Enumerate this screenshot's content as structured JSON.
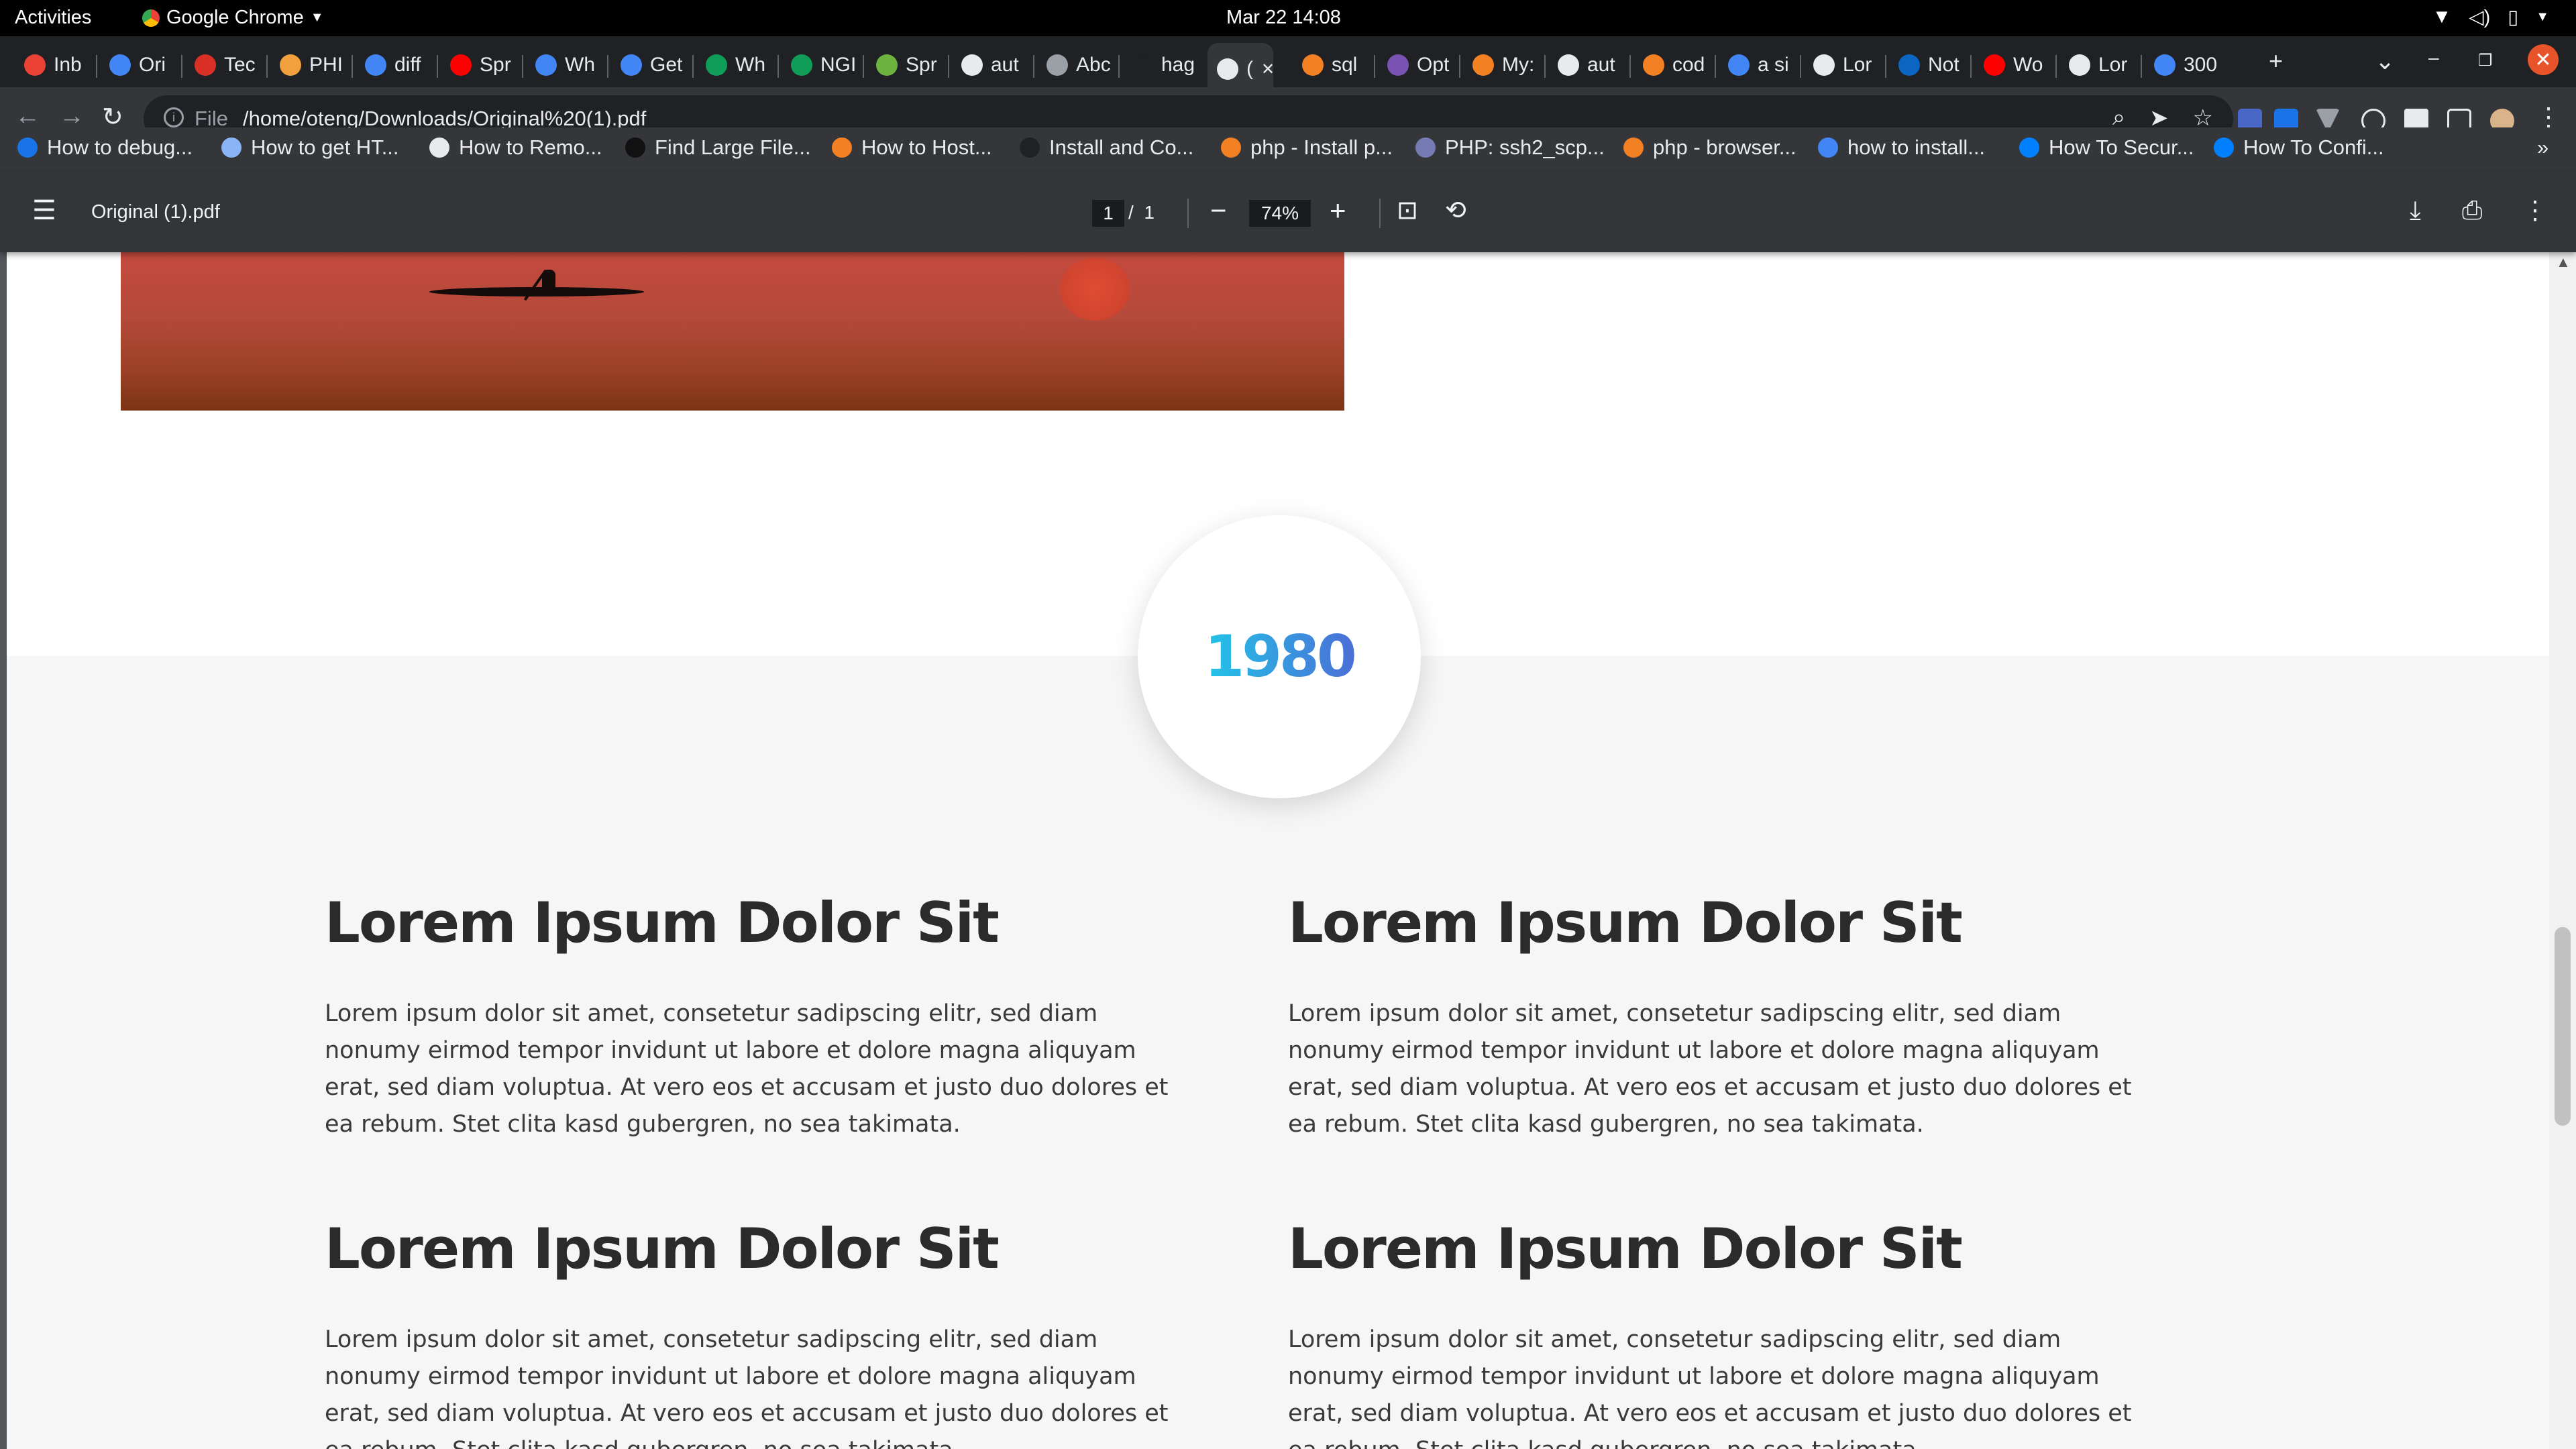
{
  "topbar": {
    "activities": "Activities",
    "app_name": "Google Chrome",
    "clock": "Mar 22  14:08"
  },
  "tabs": [
    {
      "label": "Inb",
      "favicon": "gmail-icon",
      "color": "#ea4335"
    },
    {
      "label": "Ori",
      "favicon": "docs-icon",
      "color": "#4285f4"
    },
    {
      "label": "Tec",
      "favicon": "site-icon",
      "color": "#d93025"
    },
    {
      "label": "PHI",
      "favicon": "php-icon",
      "color": "#f2a03d"
    },
    {
      "label": "diff",
      "favicon": "google-icon",
      "color": "#4285f4"
    },
    {
      "label": "Spr",
      "favicon": "youtube-icon",
      "color": "#ff0000"
    },
    {
      "label": "Wh",
      "favicon": "google-icon",
      "color": "#4285f4"
    },
    {
      "label": "Get",
      "favicon": "google-icon",
      "color": "#4285f4"
    },
    {
      "label": "Wh",
      "favicon": "nginx-icon",
      "color": "#0f9d58"
    },
    {
      "label": "NGI",
      "favicon": "nginx-icon",
      "color": "#0f9d58"
    },
    {
      "label": "Spr",
      "favicon": "spring-icon",
      "color": "#6db33f"
    },
    {
      "label": "aut",
      "favicon": "page-icon",
      "color": "#e8eaed"
    },
    {
      "label": "Abc",
      "favicon": "site-icon",
      "color": "#9aa0a6"
    },
    {
      "label": "hag",
      "favicon": "site-icon",
      "color": "#202124"
    },
    {
      "label": "(",
      "favicon": "globe-icon",
      "color": "#e8eaed"
    },
    {
      "label": "sql",
      "favicon": "stackoverflow-icon",
      "color": "#f48024"
    },
    {
      "label": "Opt",
      "favicon": "bootstrap-icon",
      "color": "#7952b3"
    },
    {
      "label": "My:",
      "favicon": "stackoverflow-icon",
      "color": "#f48024"
    },
    {
      "label": "aut",
      "favicon": "page-icon",
      "color": "#e8eaed"
    },
    {
      "label": "cod",
      "favicon": "stackoverflow-icon",
      "color": "#f48024"
    },
    {
      "label": "a si",
      "favicon": "google-icon",
      "color": "#4285f4"
    },
    {
      "label": "Lor",
      "favicon": "globe-icon",
      "color": "#e8eaed"
    },
    {
      "label": "Not",
      "favicon": "linkedin-icon",
      "color": "#0a66c2"
    },
    {
      "label": "Wo",
      "favicon": "youtube-icon",
      "color": "#ff0000"
    },
    {
      "label": "Lor",
      "favicon": "globe-icon",
      "color": "#e8eaed"
    },
    {
      "label": "300",
      "favicon": "google-icon",
      "color": "#4285f4"
    }
  ],
  "toolbar": {
    "scheme": "File",
    "url": "/home/oteng/Downloads/Original%20(1).pdf"
  },
  "bookmarks": [
    {
      "label": "How to debug...",
      "color": "#1a73e8"
    },
    {
      "label": "How to get HT...",
      "color": "#8ab4f8"
    },
    {
      "label": "How to Remo...",
      "color": "#e8eaed"
    },
    {
      "label": "Find Large File...",
      "color": "#111111"
    },
    {
      "label": "How to Host...",
      "color": "#f48024"
    },
    {
      "label": "Install and Co...",
      "color": "#202124"
    },
    {
      "label": "php - Install p...",
      "color": "#f48024"
    },
    {
      "label": "PHP: ssh2_scp...",
      "color": "#777bb3"
    },
    {
      "label": "php - browser...",
      "color": "#f48024"
    },
    {
      "label": "how to install...",
      "color": "#4285f4"
    },
    {
      "label": "How To Secur...",
      "color": "#0080ff"
    },
    {
      "label": "How To Confi...",
      "color": "#0080ff"
    }
  ],
  "pdf_viewer": {
    "filename": "Original (1).pdf",
    "current_page": "1",
    "page_separator": "/",
    "total_pages": "1",
    "zoom": "74%"
  },
  "document": {
    "year": "1980",
    "blocks": [
      {
        "title": "Lorem Ipsum Dolor Sit",
        "body": "Lorem ipsum dolor sit amet, consetetur sadipscing elitr, sed diam nonumy eirmod tempor invidunt ut labore et dolore magna aliquyam erat, sed diam voluptua. At vero eos et accusam et justo duo dolores et ea rebum. Stet clita kasd gubergren, no sea takimata."
      },
      {
        "title": "Lorem Ipsum Dolor Sit",
        "body": "Lorem ipsum dolor sit amet, consetetur sadipscing elitr, sed diam nonumy eirmod tempor invidunt ut labore et dolore magna aliquyam erat, sed diam voluptua. At vero eos et accusam et justo duo dolores et ea rebum. Stet clita kasd gubergren, no sea takimata."
      },
      {
        "title": "Lorem Ipsum Dolor Sit",
        "body": "Lorem ipsum dolor sit amet, consetetur sadipscing elitr, sed diam nonumy eirmod tempor invidunt ut labore et dolore magna aliquyam erat, sed diam voluptua. At vero eos et accusam et justo duo dolores et ea rebum. Stet clita kasd gubergren, no sea takimata."
      },
      {
        "title": "Lorem Ipsum Dolor Sit",
        "body": "Lorem ipsum dolor sit amet, consetetur sadipscing elitr, sed diam nonumy eirmod tempor invidunt ut labore et dolore magna aliquyam erat, sed diam voluptua. At vero eos et accusam et justo duo dolores et ea rebum. Stet clita kasd gubergren, no sea takimata."
      }
    ]
  },
  "colors": {
    "accent_gradient_start": "#22c4e8",
    "accent_gradient_end": "#4b6fd6",
    "close_button": "#e8542a"
  }
}
